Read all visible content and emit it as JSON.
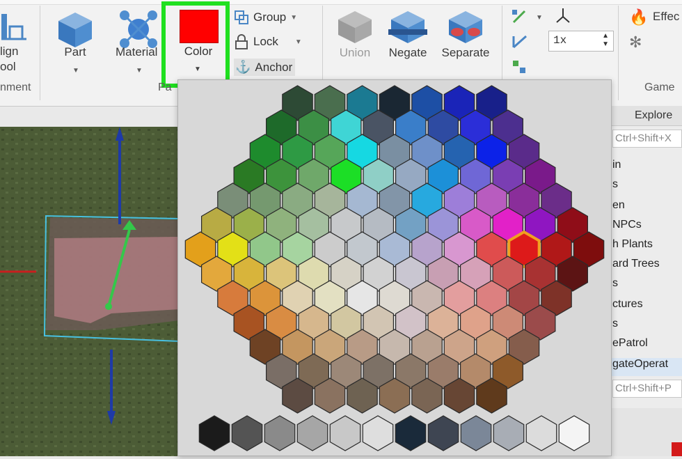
{
  "ribbon": {
    "align_tool": {
      "line1": "lign",
      "line2": "ool"
    },
    "alignment_section": "nment",
    "part": {
      "label": "Part"
    },
    "material": {
      "label": "Material"
    },
    "color": {
      "label": "Color",
      "value_hex": "#ff0000"
    },
    "parts_section_partial": "Pa",
    "group": {
      "label": "Group"
    },
    "lock": {
      "label": "Lock"
    },
    "anchor": {
      "label": "Anchor"
    },
    "union": {
      "label": "Union"
    },
    "negate": {
      "label": "Negate"
    },
    "separate": {
      "label": "Separate"
    },
    "grid_step": {
      "value": "1x"
    },
    "effects": {
      "label": "Effec"
    },
    "gameplay_section": "Game"
  },
  "explorer": {
    "tab_label": "Explore",
    "filter_placeholder": "Ctrl+Shift+X",
    "items": [
      "in",
      "s",
      "en",
      "NPCs",
      "h Plants",
      "ard Trees",
      "s",
      "ctures",
      "s",
      "ePatrol",
      "gateOperat"
    ],
    "properties_filter_placeholder": "Ctrl+Shift+P"
  },
  "color_picker": {
    "selected_hex": "#dd1a1a",
    "rows": [
      [
        "#2d4a35",
        "#4a6e4e",
        "#1b7a92",
        "#1a2733",
        "#1d4fa5",
        "#1a24b8",
        "#18208a"
      ],
      [
        "#1e6a2a",
        "#3c8f45",
        "#3fd5d5",
        "#4a5464",
        "#3a7ec9",
        "#2e4ba2",
        "#2b2ed8",
        "#4c2f8f"
      ],
      [
        "#1e8b2d",
        "#2e9a44",
        "#56a659",
        "#16d8e2",
        "#7a8fa2",
        "#6e90c9",
        "#2563b0",
        "#0c22e8",
        "#5a2b8a"
      ],
      [
        "#2a7a24",
        "#3d933c",
        "#6fa86a",
        "#1cde26",
        "#8fcfc6",
        "#96a9c2",
        "#1c90d8",
        "#6f67d6",
        "#7a3eb3",
        "#7a1a8a"
      ],
      [
        "#7a8e78",
        "#75996f",
        "#8aab82",
        "#a6b59b",
        "#a5b8d2",
        "#8295a8",
        "#27a9df",
        "#9d7ed9",
        "#b85cbf",
        "#8a2e9a",
        "#6b2d89"
      ],
      [
        "#b8ab44",
        "#9bb04a",
        "#8fb27d",
        "#a5bfa0",
        "#c7c9cb",
        "#b5bbc3",
        "#73a1c4",
        "#9b94d8",
        "#d85ac8",
        "#e221c8",
        "#8f16c1",
        "#8f0d18"
      ],
      [
        "#e3a01b",
        "#e3e017",
        "#91c78a",
        "#a6d4a0",
        "#cccccc",
        "#c2c8ce",
        "#a9bad5",
        "#b7a3cc",
        "#d897d0",
        "#e04c4c",
        "#dd1a1a",
        "#b01818",
        "#7e0d0d"
      ],
      [
        "#e3a83c",
        "#d8b43b",
        "#dcc47a",
        "#dedbaf",
        "#d6d2c6",
        "#d2d2d2",
        "#c9c6d1",
        "#c89fb3",
        "#d6a1b8",
        "#cc5a5a",
        "#a83232",
        "#5c1414"
      ],
      [
        "#d77b3c",
        "#dc943a",
        "#e0d2b2",
        "#e3e0c2",
        "#e6e6e6",
        "#dedad2",
        "#c9b7b0",
        "#e39e9e",
        "#dc8080",
        "#a34646",
        "#7e3228"
      ],
      [
        "#a85322",
        "#d98c43",
        "#d6b78d",
        "#d2c7a1",
        "#d2c5b3",
        "#d2c2c8",
        "#dcb298",
        "#dfa28a",
        "#cd8a76",
        "#9b4b4b"
      ],
      [
        "#6e4224",
        "#c49660",
        "#caa67a",
        "#b89b86",
        "#c6b8ad",
        "#b9a190",
        "#cda48a",
        "#cfa07e",
        "#855d4c"
      ],
      [
        "#7a6e66",
        "#7e6a55",
        "#9c8878",
        "#7d7166",
        "#8b7868",
        "#9a7c6a",
        "#b48a6a",
        "#8e5a2a"
      ],
      [
        "#5c4b42",
        "#8a7260",
        "#6e6252",
        "#8b6e54",
        "#7a6554",
        "#674634",
        "#5f3a1c"
      ]
    ],
    "grays": [
      "#1b1b1b",
      "#545454",
      "#8a8a8a",
      "#a6a6a6",
      "#c8c8c8",
      "#dedede",
      "#1a2a3a",
      "#3e4552",
      "#7b8798",
      "#a8adb5",
      "#dcdcdc",
      "#f4f4f4"
    ]
  }
}
